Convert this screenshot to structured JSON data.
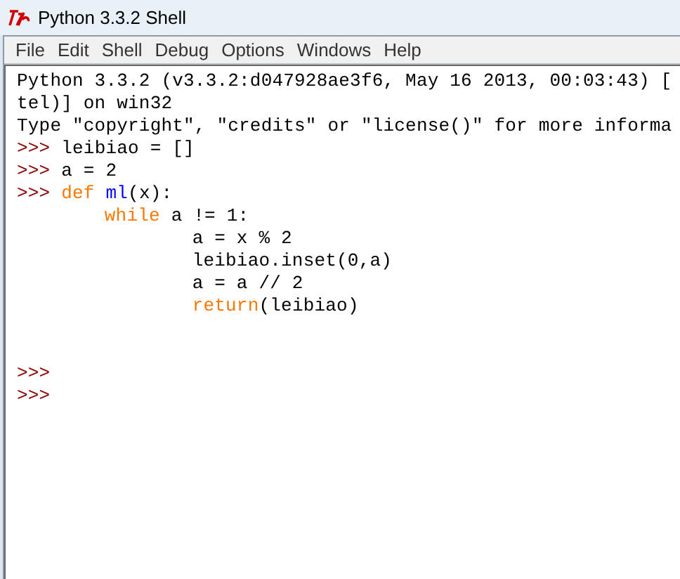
{
  "window": {
    "title": "Python 3.3.2 Shell"
  },
  "menu": [
    "File",
    "Edit",
    "Shell",
    "Debug",
    "Options",
    "Windows",
    "Help"
  ],
  "lines": [
    {
      "segments": [
        {
          "kind": "output",
          "text": "Python 3.3.2 (v3.3.2:d047928ae3f6, May 16 2013, 00:03:43) ["
        }
      ]
    },
    {
      "segments": [
        {
          "kind": "output",
          "text": "tel)] on win32"
        }
      ]
    },
    {
      "segments": [
        {
          "kind": "output",
          "text": "Type \"copyright\", \"credits\" or \"license()\" for more informa"
        }
      ]
    },
    {
      "segments": [
        {
          "kind": "prompt",
          "text": ">>> "
        },
        {
          "kind": "code",
          "text": "leibiao = []"
        }
      ]
    },
    {
      "segments": [
        {
          "kind": "prompt",
          "text": ">>> "
        },
        {
          "kind": "code",
          "text": "a = 2"
        }
      ]
    },
    {
      "segments": [
        {
          "kind": "prompt",
          "text": ">>> "
        },
        {
          "kind": "keyword",
          "text": "def"
        },
        {
          "kind": "definition",
          "text": "ml"
        },
        {
          "kind": "code",
          "text": "(x):"
        }
      ],
      "children": [
        {
          "segments": [
            {
              "kind": "keyword",
              "text": "while"
            },
            {
              "kind": "code",
              "text": " a != 1:"
            }
          ],
          "children": [
            {
              "segments": [
                {
                  "kind": "code",
                  "text": "a = x % 2"
                }
              ]
            },
            {
              "segments": [
                {
                  "kind": "code",
                  "text": "leibiao.inset(0,a)"
                }
              ]
            },
            {
              "segments": [
                {
                  "kind": "code",
                  "text": "a = a // 2"
                }
              ]
            },
            {
              "segments": [
                {
                  "kind": "keyword",
                  "text": "return"
                },
                {
                  "kind": "code",
                  "text": "(leibiao)"
                }
              ]
            }
          ]
        }
      ]
    },
    {
      "kind": "blank"
    },
    {
      "kind": "blank"
    },
    {
      "segments": [
        {
          "kind": "prompt",
          "text": ">>>"
        }
      ]
    },
    {
      "segments": [
        {
          "kind": "prompt",
          "text": ">>>"
        }
      ]
    }
  ]
}
